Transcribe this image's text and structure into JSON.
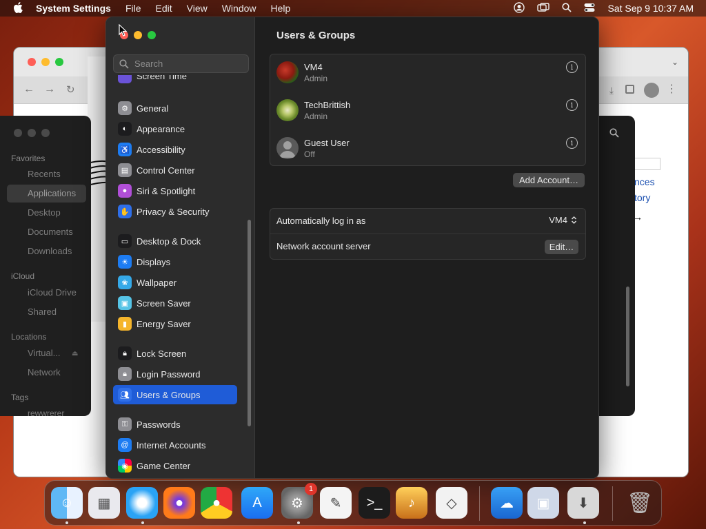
{
  "menubar": {
    "app_name": "System Settings",
    "items": [
      "File",
      "Edit",
      "View",
      "Window",
      "Help"
    ],
    "datetime": "Sat Sep 9  10:37 AM"
  },
  "finder": {
    "favorites_label": "Favorites",
    "favorites": [
      "Recents",
      "Applications",
      "Desktop",
      "Documents",
      "Downloads"
    ],
    "icloud_label": "iCloud",
    "icloud": [
      "iCloud Drive",
      "Shared"
    ],
    "locations_label": "Locations",
    "locations": [
      "Virtual...",
      "Network"
    ],
    "tags_label": "Tags",
    "tags": [
      "rewwrerer"
    ]
  },
  "browser": {
    "partial_links": [
      "nces",
      "tory"
    ]
  },
  "search": {
    "placeholder": "Search"
  },
  "sidebar": {
    "partial_top": "Screen Time",
    "items": [
      {
        "label": "General",
        "icon": "gear-icon",
        "color": "#8e8e93"
      },
      {
        "label": "Appearance",
        "icon": "appearance-icon",
        "color": "#1c1c1e"
      },
      {
        "label": "Accessibility",
        "icon": "accessibility-icon",
        "color": "#1d7cf2"
      },
      {
        "label": "Control Center",
        "icon": "control-center-icon",
        "color": "#8e8e93"
      },
      {
        "label": "Siri & Spotlight",
        "icon": "siri-icon",
        "color": "#b14fd8"
      },
      {
        "label": "Privacy & Security",
        "icon": "hand-icon",
        "color": "#2f6fe8"
      },
      {
        "label": "Desktop & Dock",
        "icon": "dock-icon",
        "color": "#1c1c1e"
      },
      {
        "label": "Displays",
        "icon": "sun-icon",
        "color": "#1d7cf2"
      },
      {
        "label": "Wallpaper",
        "icon": "wallpaper-icon",
        "color": "#35a9e8"
      },
      {
        "label": "Screen Saver",
        "icon": "screen-saver-icon",
        "color": "#56c4e6"
      },
      {
        "label": "Energy Saver",
        "icon": "battery-icon",
        "color": "#f5b52c"
      },
      {
        "label": "Lock Screen",
        "icon": "lock-icon",
        "color": "#1c1c1e"
      },
      {
        "label": "Login Password",
        "icon": "lock-icon",
        "color": "#8e8e93"
      },
      {
        "label": "Users & Groups",
        "icon": "users-icon",
        "color": "#2f6fe8"
      },
      {
        "label": "Passwords",
        "icon": "key-icon",
        "color": "#8e8e93"
      },
      {
        "label": "Internet Accounts",
        "icon": "at-icon",
        "color": "#1d7cf2"
      },
      {
        "label": "Game Center",
        "icon": "game-center-icon",
        "color": "#f0f0f0"
      }
    ]
  },
  "content": {
    "title": "Users & Groups",
    "users": [
      {
        "name": "VM4",
        "role": "Admin"
      },
      {
        "name": "TechBrittish",
        "role": "Admin"
      },
      {
        "name": "Guest User",
        "role": "Off"
      }
    ],
    "add_account": "Add Account…",
    "auto_login_label": "Automatically log in as",
    "auto_login_value": "VM4",
    "network_label": "Network account server",
    "edit_label": "Edit…",
    "help_label": "?"
  },
  "dock": {
    "badge_count": "1",
    "apps": [
      "Finder",
      "Launchpad",
      "Safari",
      "Firefox",
      "Chrome",
      "App Store",
      "System Settings",
      "TextEdit",
      "Terminal",
      "GarageBand",
      "Visual Studio Code",
      "Weather",
      "VirtualBox",
      "Installer",
      "Trash"
    ]
  }
}
